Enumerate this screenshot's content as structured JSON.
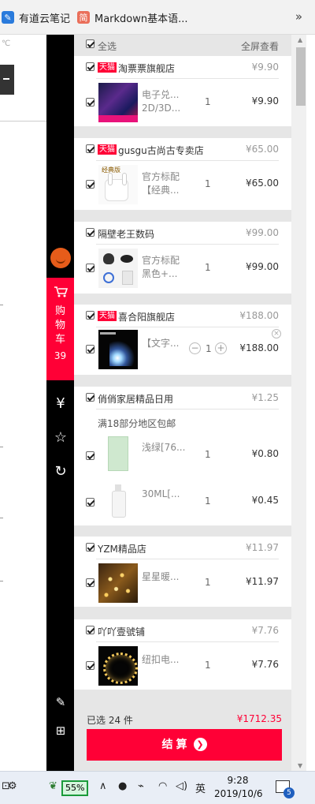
{
  "bookmarks": {
    "items": [
      {
        "label": "有道云笔记",
        "icon": "youdao-note-icon"
      },
      {
        "label": "Markdown基本语...",
        "icon": "jian-bookmark-icon",
        "icon_glyph": "简"
      }
    ],
    "more": "»"
  },
  "left_page": {
    "dropdown": "℃"
  },
  "sidebar": {
    "cart_label": [
      "购",
      "物",
      "车"
    ],
    "cart_count": "39",
    "icons": {
      "coupon": "¥",
      "favorite": "☆",
      "history": "↻",
      "feedback": "✎",
      "qrcode": "⊞"
    }
  },
  "cart": {
    "select_all": "全选",
    "full_screen": "全屏查看",
    "tmall_badge": "天猫",
    "shops": [
      {
        "name": "淘票票旗舰店",
        "tmall": true,
        "total": "¥9.90",
        "items": [
          {
            "name": "电子兑...",
            "name2": "2D/3D...",
            "qty": "1",
            "price": "¥9.90"
          }
        ]
      },
      {
        "name": "gusgu古尚古专卖店",
        "tmall": true,
        "total": "¥65.00",
        "items": [
          {
            "name": "官方标配",
            "name2": "【经典...",
            "qty": "1",
            "price": "¥65.00",
            "thumb_label": "经典版"
          }
        ]
      },
      {
        "name": "隔壁老王数码",
        "tmall": false,
        "total": "¥99.00",
        "items": [
          {
            "name": "官方标配",
            "name2": "黑色+...",
            "qty": "1",
            "price": "¥99.00"
          }
        ]
      },
      {
        "name": "喜合阳旗舰店",
        "tmall": true,
        "total": "¥188.00",
        "items": [
          {
            "name": "【文字...",
            "name2": "",
            "qty": "1",
            "price": "¥188.00",
            "minus": "−",
            "plus": "+",
            "close": "×"
          }
        ]
      },
      {
        "name": "俏俏家居精品日用",
        "tmall": false,
        "total": "¥1.25",
        "promo": "满18部分地区包邮",
        "items": [
          {
            "name": "浅绿[76...",
            "name2": "",
            "qty": "1",
            "price": "¥0.80"
          },
          {
            "name": "30ML[...",
            "name2": "",
            "qty": "1",
            "price": "¥0.45"
          }
        ]
      },
      {
        "name": "YZM精品店",
        "tmall": false,
        "total": "¥11.97",
        "items": [
          {
            "name": "星星暖...",
            "name2": "",
            "qty": "1",
            "price": "¥11.97"
          }
        ]
      },
      {
        "name": "吖吖壹號铺",
        "tmall": false,
        "total": "¥7.76",
        "items": [
          {
            "name": "纽扣电...",
            "name2": "",
            "qty": "1",
            "price": "¥7.76"
          }
        ]
      }
    ],
    "footer": {
      "selected": "已选 24 件",
      "total": "¥1712.35",
      "checkout": "结算",
      "checkout_arrow": "❯"
    }
  },
  "taskbar": {
    "settings_icon": "⚙",
    "battery": "55%",
    "lang": "英",
    "time": "9:28",
    "date": "2019/10/6",
    "notifications": "5"
  }
}
